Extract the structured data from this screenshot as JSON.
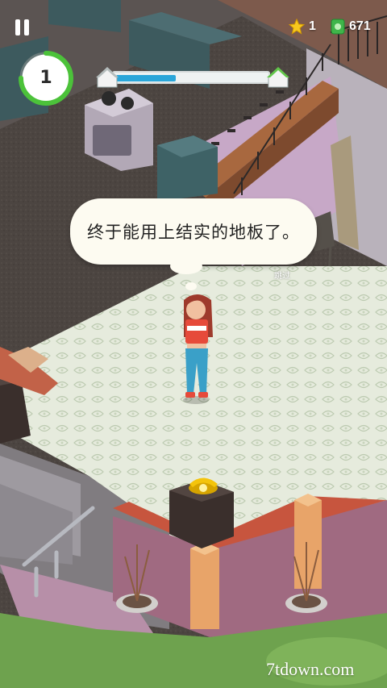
{
  "hud": {
    "level": "1",
    "level_progress": 0.75,
    "renovation_progress": 0.4,
    "stars": "1",
    "cash": "671"
  },
  "dialogue": {
    "text": "终于能用上结实的地板了。",
    "skip_label": "跳过"
  },
  "watermark": "7tdown.com",
  "colors": {
    "progress_fill": "#2aa6d9",
    "level_ring": "#4cc23a",
    "house_roof": "#62c64a",
    "floor": "#e7ece0"
  },
  "icons": [
    "pause-icon",
    "star-icon",
    "cash-icon",
    "house-start-icon",
    "house-goal-icon",
    "telephone-icon"
  ]
}
